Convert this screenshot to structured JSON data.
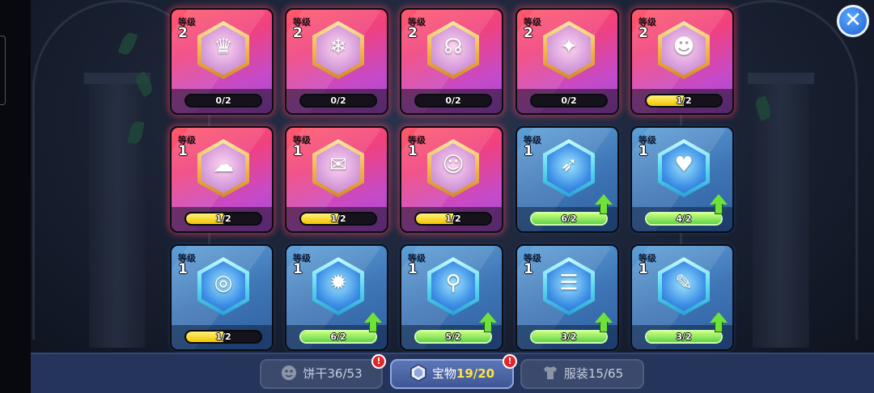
{
  "close_label": "✕",
  "cards": [
    {
      "tier": "red",
      "level_label": "等级",
      "level": "2",
      "progress": "0/2",
      "fill_pct": 0,
      "upgrade": false,
      "icon": "flame-crown-icon",
      "glyph": "♛"
    },
    {
      "tier": "red",
      "level_label": "等级",
      "level": "2",
      "progress": "0/2",
      "fill_pct": 0,
      "upgrade": false,
      "icon": "crystal-branch-icon",
      "glyph": "❄"
    },
    {
      "tier": "red",
      "level_label": "等级",
      "level": "2",
      "progress": "0/2",
      "fill_pct": 0,
      "upgrade": false,
      "icon": "flamingo-float-icon",
      "glyph": "☊"
    },
    {
      "tier": "red",
      "level_label": "等级",
      "level": "2",
      "progress": "0/2",
      "fill_pct": 0,
      "upgrade": false,
      "icon": "blue-tome-icon",
      "glyph": "✦"
    },
    {
      "tier": "red",
      "level_label": "等级",
      "level": "2",
      "progress": "1/2",
      "fill_pct": 50,
      "upgrade": false,
      "icon": "mummy-head-icon",
      "glyph": "☻"
    },
    {
      "tier": "red",
      "level_label": "等级",
      "level": "1",
      "progress": "1/2",
      "fill_pct": 50,
      "upgrade": false,
      "icon": "cloud-dragon-icon",
      "glyph": "☁"
    },
    {
      "tier": "red",
      "level_label": "等级",
      "level": "1",
      "progress": "1/2",
      "fill_pct": 50,
      "upgrade": false,
      "icon": "treasure-map-icon",
      "glyph": "✉"
    },
    {
      "tier": "red",
      "level_label": "等级",
      "level": "1",
      "progress": "1/2",
      "fill_pct": 50,
      "upgrade": false,
      "icon": "cat-balloon-icon",
      "glyph": "☺"
    },
    {
      "tier": "blue",
      "level_label": "等级",
      "level": "1",
      "progress": "6/2",
      "fill_pct": 100,
      "upgrade": true,
      "icon": "bone-bow-icon",
      "glyph": "➶"
    },
    {
      "tier": "blue",
      "level_label": "等级",
      "level": "1",
      "progress": "4/2",
      "fill_pct": 100,
      "upgrade": true,
      "icon": "heart-compass-icon",
      "glyph": "♥"
    },
    {
      "tier": "blue",
      "level_label": "等级",
      "level": "1",
      "progress": "1/2",
      "fill_pct": 50,
      "upgrade": false,
      "icon": "spiral-shell-icon",
      "glyph": "◎"
    },
    {
      "tier": "blue",
      "level_label": "等级",
      "level": "1",
      "progress": "6/2",
      "fill_pct": 100,
      "upgrade": true,
      "icon": "dark-crystal-icon",
      "glyph": "✹"
    },
    {
      "tier": "blue",
      "level_label": "等级",
      "level": "1",
      "progress": "5/2",
      "fill_pct": 100,
      "upgrade": true,
      "icon": "magic-wand-icon",
      "glyph": "⚲"
    },
    {
      "tier": "blue",
      "level_label": "等级",
      "level": "1",
      "progress": "3/2",
      "fill_pct": 100,
      "upgrade": true,
      "icon": "recipe-book-icon",
      "glyph": "☰"
    },
    {
      "tier": "blue",
      "level_label": "等级",
      "level": "1",
      "progress": "3/2",
      "fill_pct": 100,
      "upgrade": true,
      "icon": "old-scroll-icon",
      "glyph": "✎"
    }
  ],
  "tabs": [
    {
      "name": "tab-cookies",
      "label": "饼干",
      "count": "36/53",
      "active": false,
      "alert": true,
      "alert_text": "!",
      "icon": "cookie-face-icon"
    },
    {
      "name": "tab-treasures",
      "label": "宝物",
      "count": "19/20",
      "active": true,
      "alert": true,
      "alert_text": "!",
      "icon": "hexagon-gem-icon"
    },
    {
      "name": "tab-costumes",
      "label": "服装",
      "count": "15/65",
      "active": false,
      "alert": false,
      "alert_text": "",
      "icon": "shirt-icon"
    }
  ]
}
